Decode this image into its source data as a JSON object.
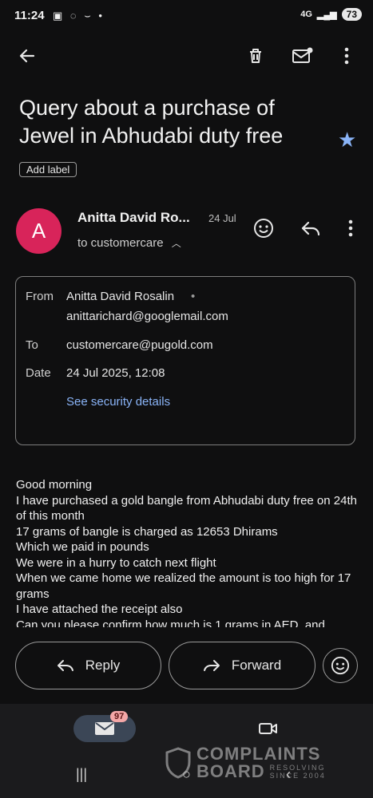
{
  "status_bar": {
    "time": "11:24",
    "battery": "73",
    "network": "4G"
  },
  "toolbar": {
    "back_icon": "back-arrow-icon",
    "delete_icon": "trash-icon",
    "mark_unread_icon": "mail-unread-icon",
    "more_icon": "more-vert-icon"
  },
  "email": {
    "subject": "Query about a purchase of Jewel in Abhudabi duty free",
    "add_label": "Add label",
    "sender": {
      "avatar_letter": "A",
      "avatar_color": "#d8245a",
      "name_short": "Anitta David Ro...",
      "date_short": "24 Jul",
      "to_line": "to customercare"
    },
    "details": {
      "from_label": "From",
      "from_name": "Anitta David Rosalin",
      "from_email": "anittarichard@googlemail.com",
      "to_label": "To",
      "to_value": "customercare@pugold.com",
      "date_label": "Date",
      "date_value": "24 Jul 2025, 12:08",
      "security_link": "See security details"
    },
    "body_lines": [
      "Good morning",
      "I have purchased a gold bangle from Abhudabi duty free on 24th of this month",
      "17 grams of bangle is charged as 12653 Dhirams",
      "Which we paid in pounds",
      "We were in a hurry to catch next flight",
      "When we came home we realized the amount is too high for 17 grams",
      "I have attached the receipt also",
      "Can you please confirm how much is 1 grams in AED, and"
    ]
  },
  "actions": {
    "reply": "Reply",
    "forward": "Forward",
    "emoji_icon": "emoji-icon"
  },
  "bottom_nav": {
    "mail_badge": "97",
    "mail_icon": "mail-icon",
    "meet_icon": "video-icon"
  },
  "watermark": {
    "line1": "COMPLAINTS",
    "line2": "BOARD",
    "tag1": "RESOLVING",
    "tag2": "SINCE 2004"
  },
  "colors": {
    "background": "#0f0f10",
    "accent": "#8ab4f8",
    "avatar": "#d8245a"
  }
}
